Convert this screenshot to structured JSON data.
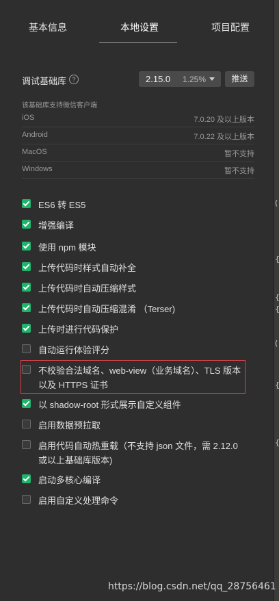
{
  "tabs": [
    {
      "label": "基本信息"
    },
    {
      "label": "本地设置"
    },
    {
      "label": "项目配置"
    }
  ],
  "base_library": {
    "label": "调试基础库",
    "help_icon": "?",
    "version": "2.15.0",
    "percent": "1.25%",
    "push_label": "推送"
  },
  "support": {
    "heading": "该基础库支持微信客户端",
    "rows": [
      {
        "os": "iOS",
        "value": "7.0.20 及以上版本"
      },
      {
        "os": "Android",
        "value": "7.0.22 及以上版本"
      },
      {
        "os": "MacOS",
        "value": "暂不支持"
      },
      {
        "os": "Windows",
        "value": "暂不支持"
      }
    ]
  },
  "options": [
    {
      "label": "ES6 转 ES5",
      "checked": true
    },
    {
      "label": "增强编译",
      "checked": true
    },
    {
      "label": "使用 npm 模块",
      "checked": true
    },
    {
      "label": "上传代码时样式自动补全",
      "checked": true
    },
    {
      "label": "上传代码时自动压缩样式",
      "checked": true
    },
    {
      "label": "上传代码时自动压缩混淆 （Terser)",
      "checked": true
    },
    {
      "label": "上传时进行代码保护",
      "checked": true
    },
    {
      "label": "自动运行体验评分",
      "checked": false
    },
    {
      "label": "不校验合法域名、web-view（业务域名）、TLS 版本以及 HTTPS 证书",
      "checked": false
    },
    {
      "label": "以 shadow-root 形式展示自定义组件",
      "checked": true
    },
    {
      "label": "启用数据预拉取",
      "checked": false
    },
    {
      "label": "启用代码自动热重载（不支持 json 文件，需 2.12.0 或以上基础库版本)",
      "checked": false
    },
    {
      "label": "启动多核心编译",
      "checked": true
    },
    {
      "label": "启用自定义处理命令",
      "checked": false
    }
  ],
  "colors": {
    "accent_checkbox": "#1fb36b",
    "highlight_border": "#e0454b"
  },
  "right_edge_glyphs": [
    "(",
    "{",
    "{",
    "{",
    "(",
    "{",
    "{"
  ],
  "watermark": "https://blog.csdn.net/qq_28756461"
}
